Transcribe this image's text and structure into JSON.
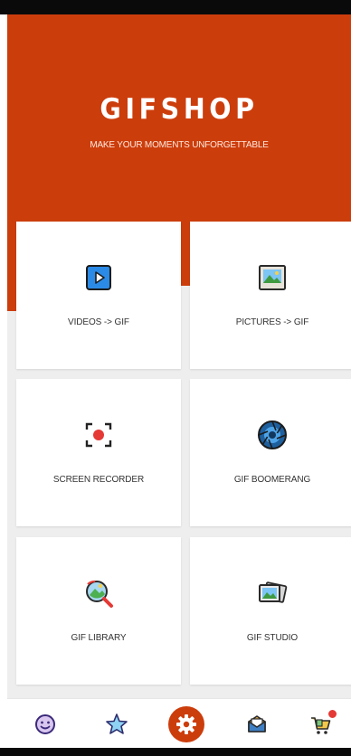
{
  "app": {
    "title": "GIFSHOP",
    "tagline": "MAKE YOUR MOMENTS UNFORGETTABLE",
    "brand_color": "#cc3d0c"
  },
  "cards": [
    {
      "label": "VIDEOS -> GIF",
      "icon": "video-play-icon"
    },
    {
      "label": "PICTURES -> GIF",
      "icon": "picture-icon"
    },
    {
      "label": "SCREEN RECORDER",
      "icon": "record-icon"
    },
    {
      "label": "GIF BOOMERANG",
      "icon": "camera-aperture-icon"
    },
    {
      "label": "GIF LIBRARY",
      "icon": "search-image-icon"
    },
    {
      "label": "GIF STUDIO",
      "icon": "image-stack-icon"
    }
  ],
  "bottom_nav": {
    "items": [
      {
        "icon": "smiley-icon"
      },
      {
        "icon": "star-icon"
      },
      {
        "icon": "settings-gear-icon",
        "active": true
      },
      {
        "icon": "mail-icon"
      },
      {
        "icon": "cart-icon",
        "has_badge": true
      }
    ]
  }
}
